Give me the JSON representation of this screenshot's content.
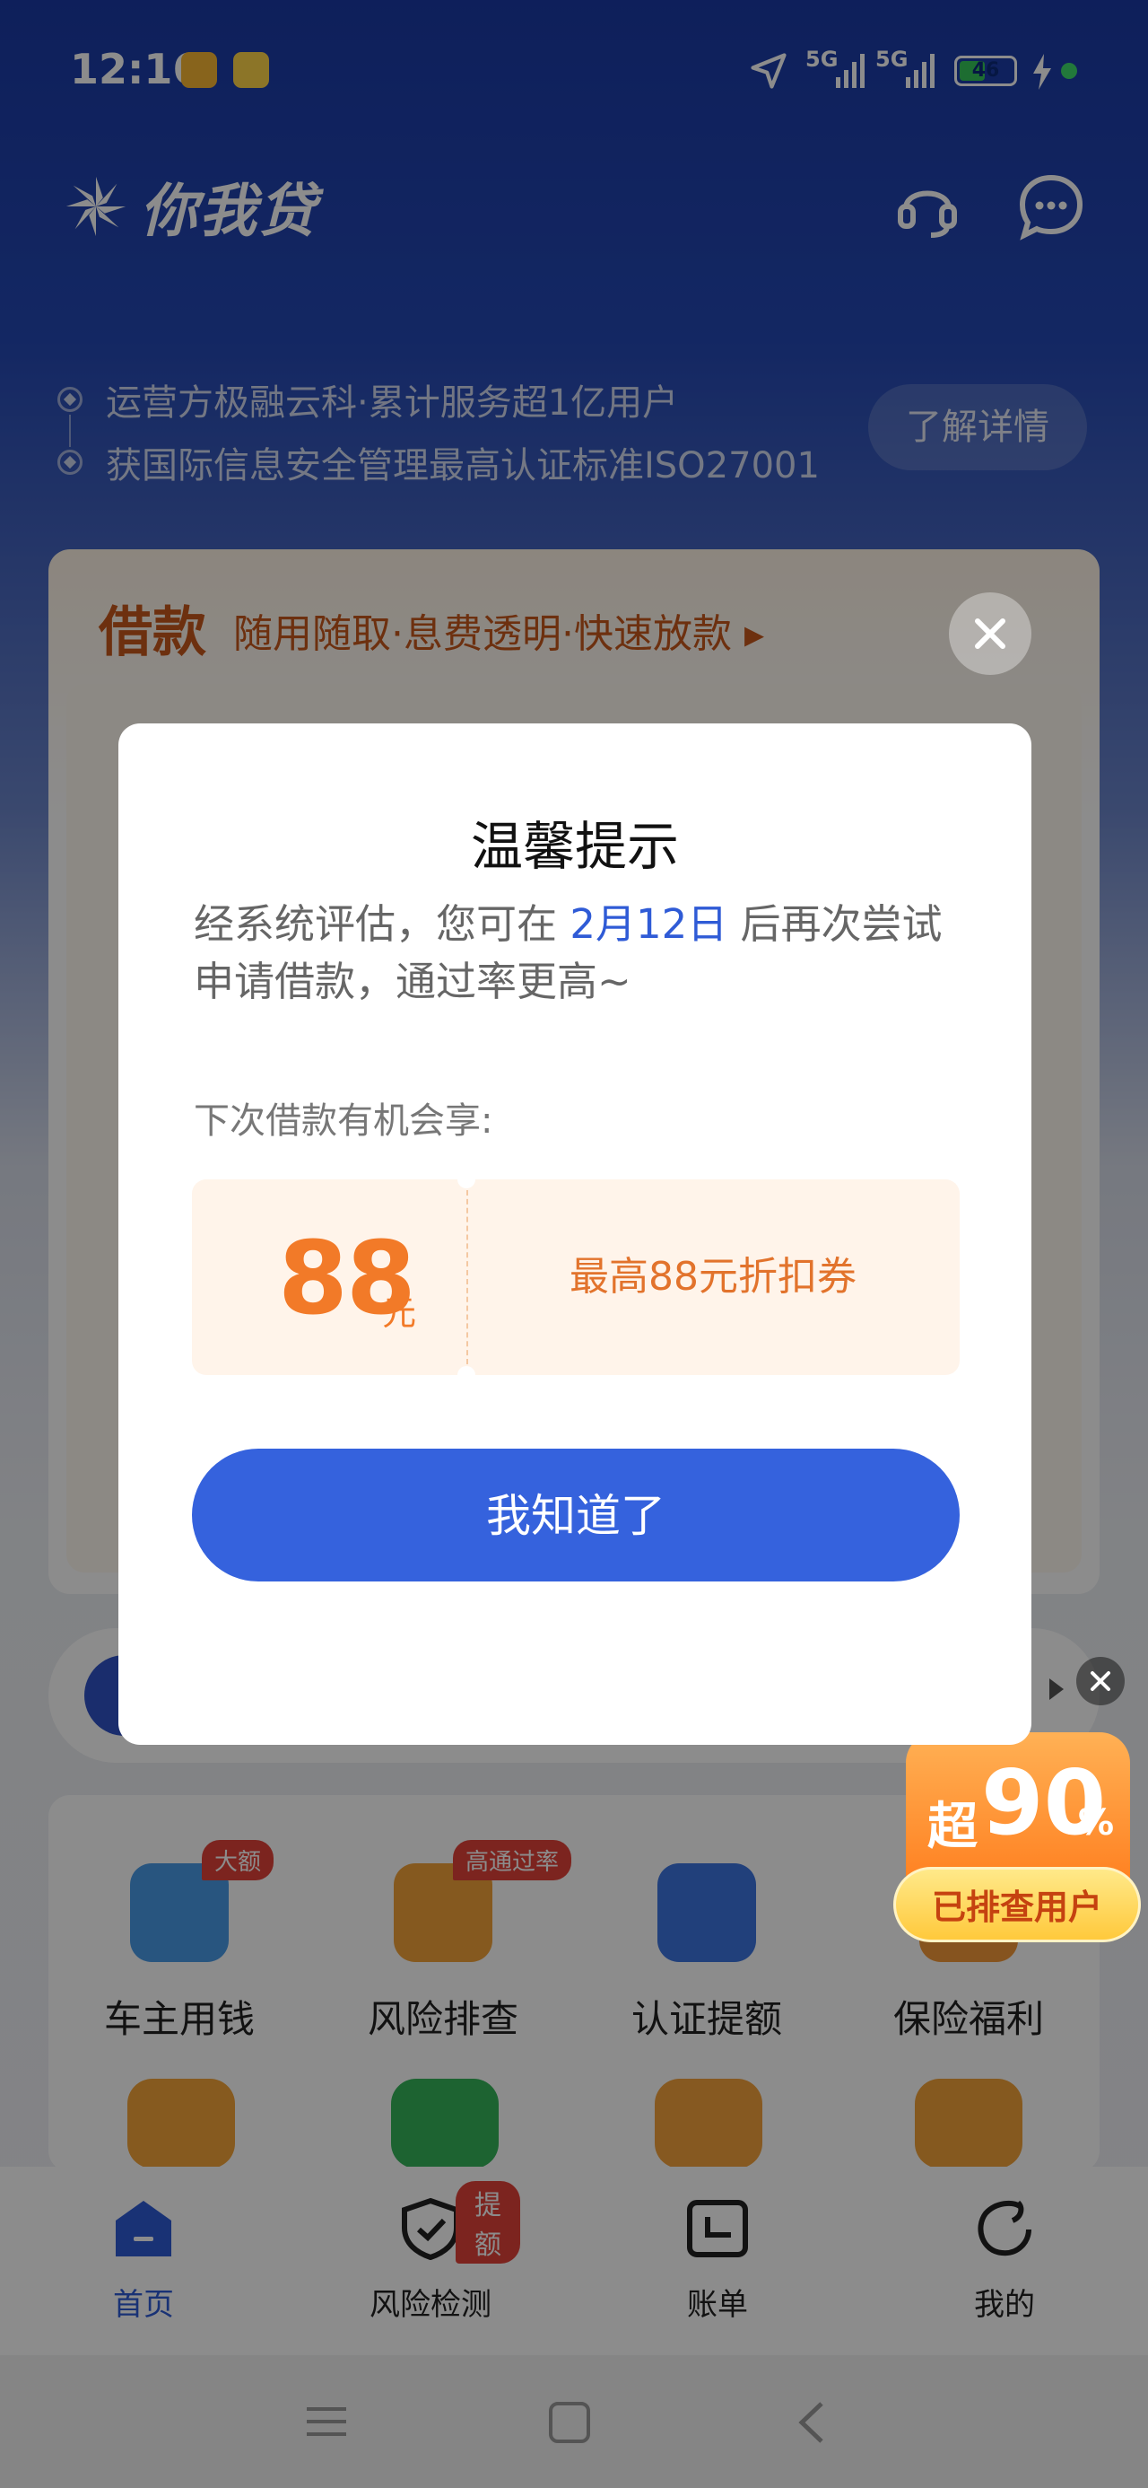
{
  "status_bar": {
    "time": "12:16",
    "battery": "46",
    "net1": "5G",
    "net2": "5G"
  },
  "header": {
    "app_name": "你我贷"
  },
  "info": {
    "line1": "运营方极融云科·累计服务超1亿用户",
    "line2": "获国际信息安全管理最高认证标准ISO27001",
    "more_button": "了解详情"
  },
  "loan_card": {
    "title": "借款",
    "subtitle": "随用随取·息费透明·快速放款 ▸"
  },
  "services": [
    {
      "label": "车主用钱",
      "tag": "大额"
    },
    {
      "label": "风险排查",
      "tag": "高通过率"
    },
    {
      "label": "认证提额",
      "tag": ""
    },
    {
      "label": "保险福利",
      "tag": ""
    }
  ],
  "promo": {
    "prefix": "超",
    "value": "90",
    "suffix": "%",
    "label": "已排查用户"
  },
  "tabs": [
    {
      "label": "首页",
      "badge": ""
    },
    {
      "label": "风险检测",
      "badge": "提额"
    },
    {
      "label": "账单",
      "badge": ""
    },
    {
      "label": "我的",
      "badge": ""
    }
  ],
  "dialog": {
    "title": "温馨提示",
    "message_pre": "经系统评估，您可在 ",
    "message_date": "2月12日",
    "message_post": " 后再次尝试申请借款，通过率更高~",
    "subtitle": "下次借款有机会享:",
    "coupon_amount": "88",
    "coupon_unit": "元",
    "coupon_desc": "最高88元折扣券",
    "button": "我知道了"
  },
  "colors": {
    "brand_blue": "#3562dd",
    "orange": "#f27a28",
    "badge_red": "#e2433a"
  }
}
